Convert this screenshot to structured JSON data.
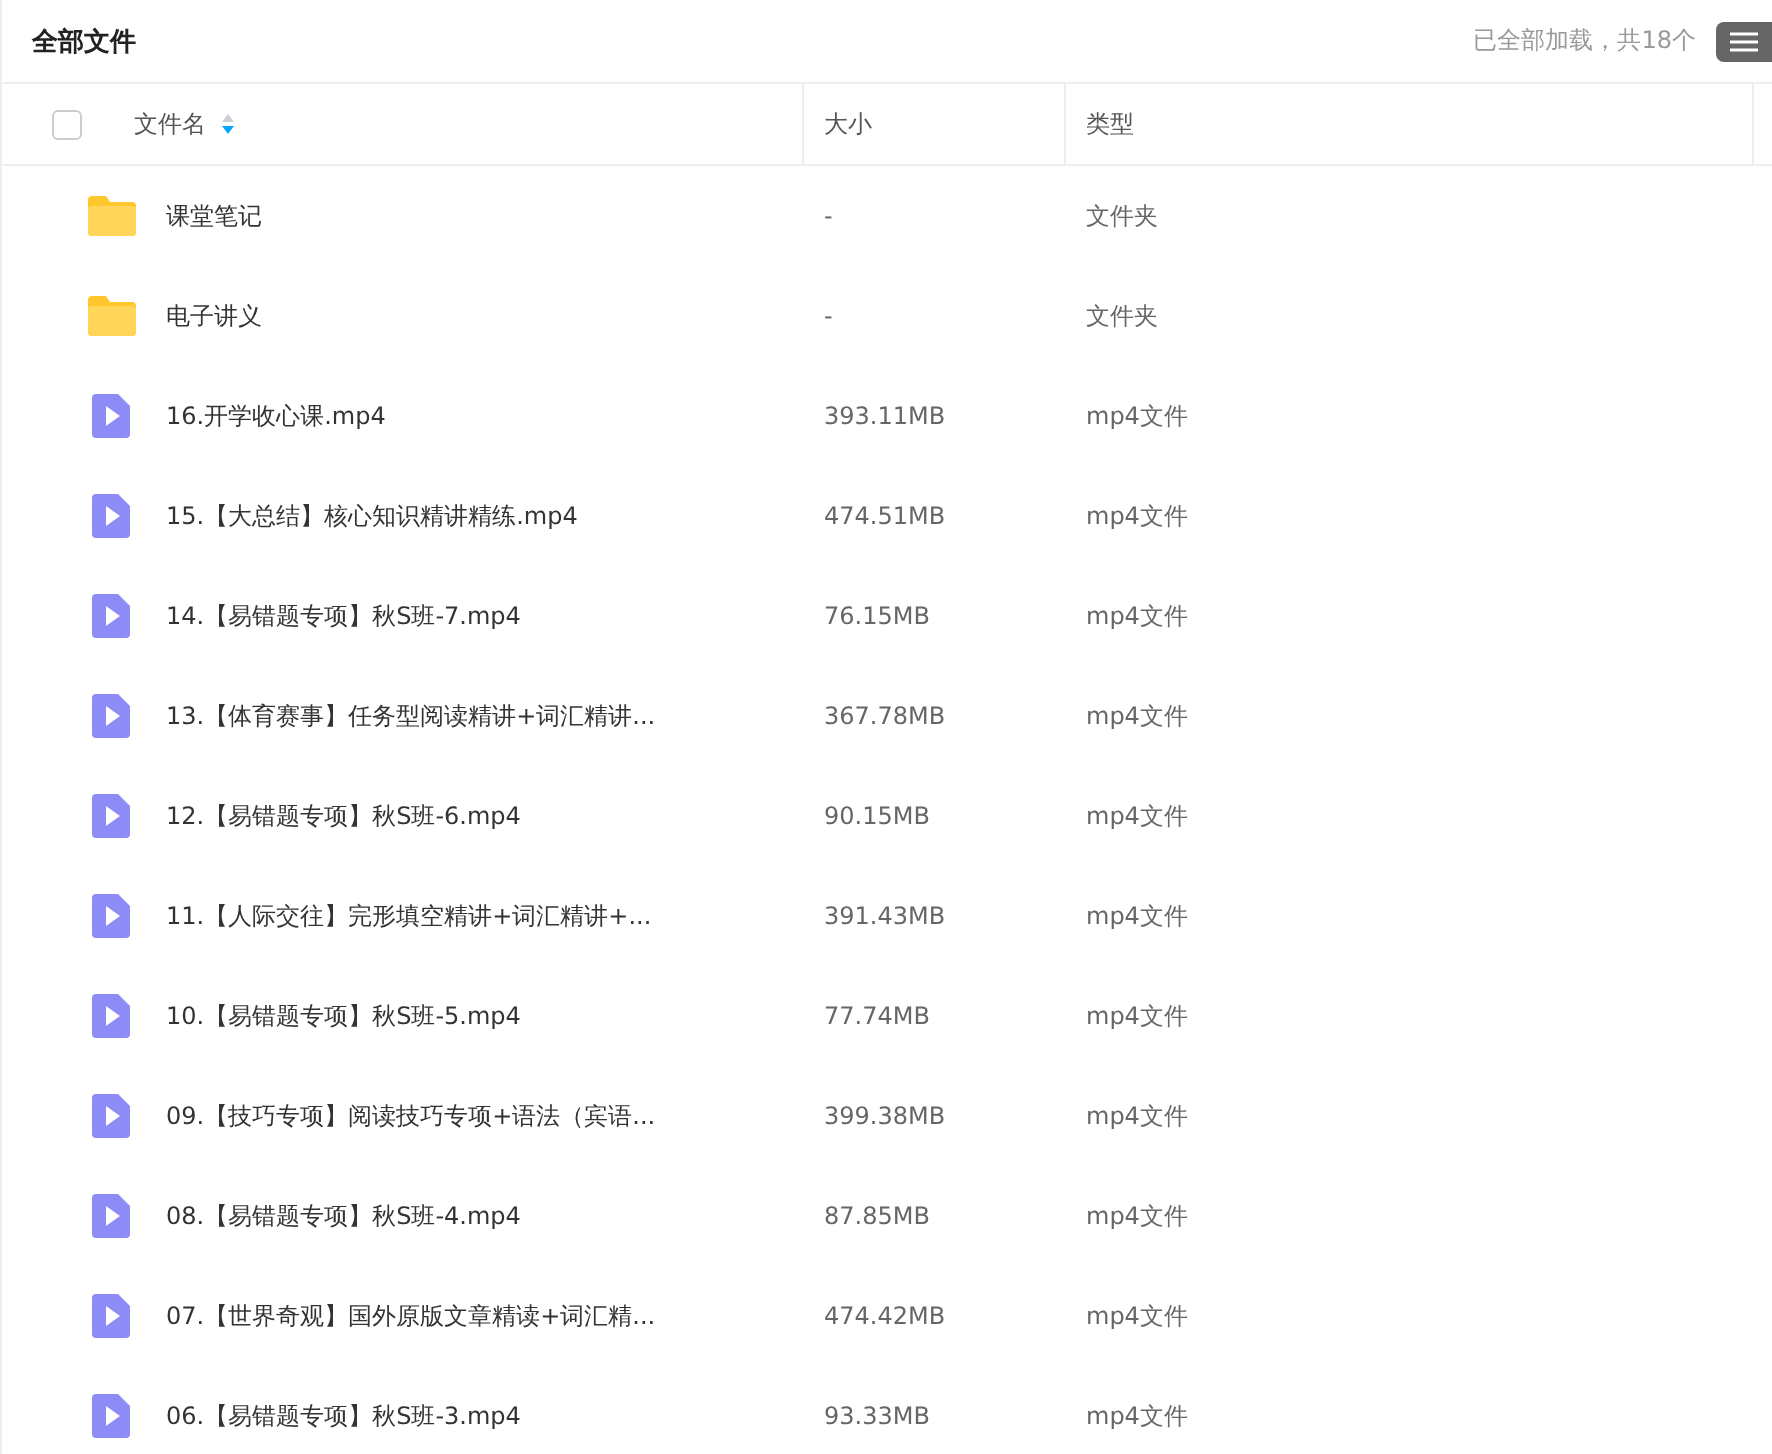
{
  "header": {
    "title": "全部文件",
    "status": "已全部加载，共18个"
  },
  "columns": [
    {
      "label": "文件名",
      "sorted_descending": true
    },
    {
      "label": "大小"
    },
    {
      "label": "类型"
    }
  ],
  "select_all": {
    "checked": false
  },
  "rows": [
    {
      "kind": "folder",
      "name": "课堂笔记",
      "size": "-",
      "type": "文件夹"
    },
    {
      "kind": "folder",
      "name": "电子讲义",
      "size": "-",
      "type": "文件夹"
    },
    {
      "kind": "video",
      "name": "16.开学收心课.mp4",
      "size": "393.11MB",
      "type": "mp4文件"
    },
    {
      "kind": "video",
      "name": "15.【大总结】核心知识精讲精练.mp4",
      "size": "474.51MB",
      "type": "mp4文件"
    },
    {
      "kind": "video",
      "name": "14.【易错题专项】秋S班-7.mp4",
      "size": "76.15MB",
      "type": "mp4文件"
    },
    {
      "kind": "video",
      "name": "13.【体育赛事】任务型阅读精讲+词汇精讲...",
      "size": "367.78MB",
      "type": "mp4文件"
    },
    {
      "kind": "video",
      "name": "12.【易错题专项】秋S班-6.mp4",
      "size": "90.15MB",
      "type": "mp4文件"
    },
    {
      "kind": "video",
      "name": "11.【人际交往】完形填空精讲+词汇精讲+...",
      "size": "391.43MB",
      "type": "mp4文件"
    },
    {
      "kind": "video",
      "name": "10.【易错题专项】秋S班-5.mp4",
      "size": "77.74MB",
      "type": "mp4文件"
    },
    {
      "kind": "video",
      "name": "09.【技巧专项】阅读技巧专项+语法（宾语...",
      "size": "399.38MB",
      "type": "mp4文件"
    },
    {
      "kind": "video",
      "name": "08.【易错题专项】秋S班-4.mp4",
      "size": "87.85MB",
      "type": "mp4文件"
    },
    {
      "kind": "video",
      "name": "07.【世界奇观】国外原版文章精读+词汇精...",
      "size": "474.42MB",
      "type": "mp4文件"
    },
    {
      "kind": "video",
      "name": "06.【易错题专项】秋S班-3.mp4",
      "size": "93.33MB",
      "type": "mp4文件"
    }
  ]
}
